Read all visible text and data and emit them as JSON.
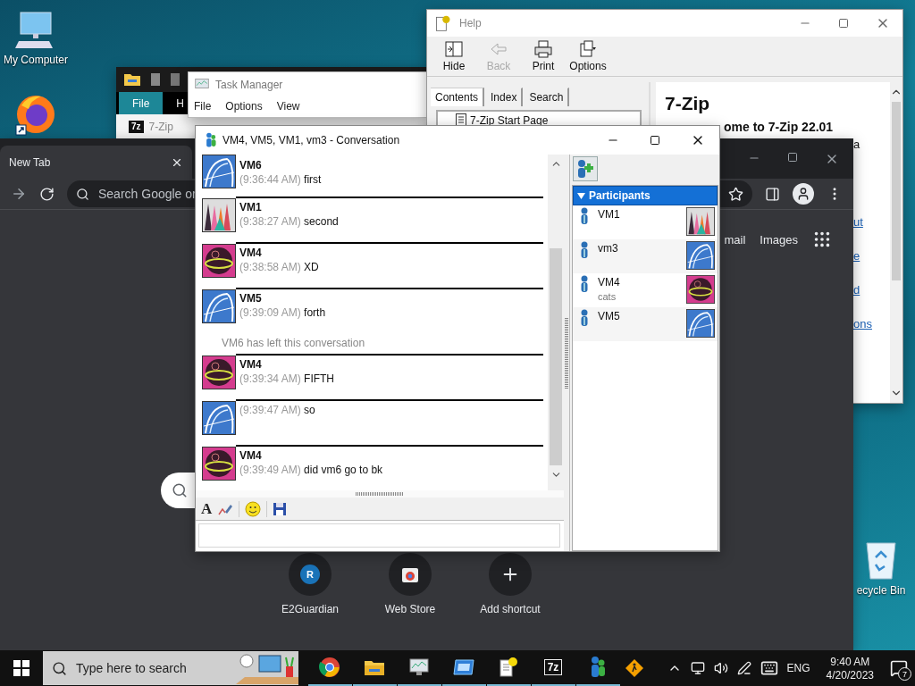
{
  "desktop": {
    "icons": [
      {
        "kind": "computer",
        "label": "My Computer"
      },
      {
        "kind": "firefox"
      },
      {
        "kind": "recycle_bin",
        "label": "ecycle Bin"
      }
    ]
  },
  "explorer": {
    "tabs": [
      {
        "label": "File",
        "selected": true
      },
      {
        "label": "H",
        "selected": false
      }
    ],
    "item": {
      "icon_text": "7z",
      "label": "7-Zip"
    }
  },
  "task_manager": {
    "title": "Task Manager",
    "menu": [
      "File",
      "Options",
      "View"
    ]
  },
  "help": {
    "title": "Help",
    "toolbar": [
      {
        "kind": "hide",
        "label": "Hide",
        "disabled": false
      },
      {
        "kind": "back",
        "label": "Back",
        "disabled": true
      },
      {
        "kind": "print",
        "label": "Print",
        "disabled": false
      },
      {
        "kind": "options",
        "label": "Options",
        "disabled": false
      }
    ],
    "tabs": [
      {
        "label": "Contents",
        "selected": true
      },
      {
        "label": "Index",
        "selected": false
      },
      {
        "label": "Search",
        "selected": false
      }
    ],
    "tree": [
      {
        "label": "7-Zip Start Page"
      }
    ],
    "heading": "7-Zip",
    "subheading": "ome to 7-Zip 22.01",
    "fragment": "a",
    "links": [
      "ut",
      "e",
      "d",
      "ons"
    ]
  },
  "browser": {
    "tab": "New Tab",
    "search_placeholder": "Search Google or",
    "header_links": [
      "mail",
      "Images"
    ],
    "shortcuts": [
      {
        "kind": "letter",
        "letter": "R",
        "label": "E2Guardian"
      },
      {
        "kind": "store",
        "label": "Web Store"
      },
      {
        "kind": "add",
        "label": "Add shortcut"
      }
    ]
  },
  "conversation": {
    "title": "VM4, VM5, VM1, vm3 - Conversation",
    "messages": [
      {
        "kind": "message",
        "avatar": {
          "kind": "coaster"
        },
        "sender": "VM6",
        "time": "(9:36:44 AM)",
        "text": "first"
      },
      {
        "kind": "message",
        "avatar": {
          "kind": "crayons"
        },
        "sender": "VM1",
        "time": "(9:38:27 AM)",
        "text": "second"
      },
      {
        "kind": "message",
        "avatar": {
          "kind": "ball"
        },
        "sender": "VM4",
        "time": "(9:38:58 AM)",
        "text": "XD"
      },
      {
        "kind": "message",
        "avatar": {
          "kind": "coaster"
        },
        "sender": "VM5",
        "time": "(9:39:09 AM)",
        "text": "forth"
      },
      {
        "kind": "notice",
        "text": "VM6 has left this conversation"
      },
      {
        "kind": "message",
        "avatar": {
          "kind": "ball"
        },
        "sender": "VM4",
        "time": "(9:39:34 AM)",
        "text": "FIFTH"
      },
      {
        "kind": "message",
        "avatar": {
          "kind": "coaster"
        },
        "time": "(9:39:47 AM)",
        "text": "so"
      },
      {
        "kind": "message",
        "avatar": {
          "kind": "ball"
        },
        "sender": "VM4",
        "time": "(9:39:49 AM)",
        "text": "did vm6 go to bk"
      }
    ],
    "font_button": "A",
    "participants_header": "Participants",
    "participants": [
      {
        "name": "VM1",
        "avatar": {
          "kind": "crayons"
        }
      },
      {
        "name": "vm3",
        "avatar": {
          "kind": "coaster"
        }
      },
      {
        "name": "VM4",
        "status": "cats",
        "avatar": {
          "kind": "ball"
        }
      },
      {
        "name": "VM5",
        "avatar": {
          "kind": "coaster"
        }
      }
    ]
  },
  "taskbar": {
    "search_placeholder": "Type here to search",
    "apps": [
      {
        "kind": "chrome"
      },
      {
        "kind": "folder"
      },
      {
        "kind": "taskmgr"
      },
      {
        "kind": "remote"
      },
      {
        "kind": "help"
      },
      {
        "kind": "archive",
        "label": "7z"
      },
      {
        "kind": "messenger"
      }
    ],
    "language": "ENG",
    "time": "9:40 AM",
    "date": "4/20/2023",
    "notifications": "7"
  }
}
